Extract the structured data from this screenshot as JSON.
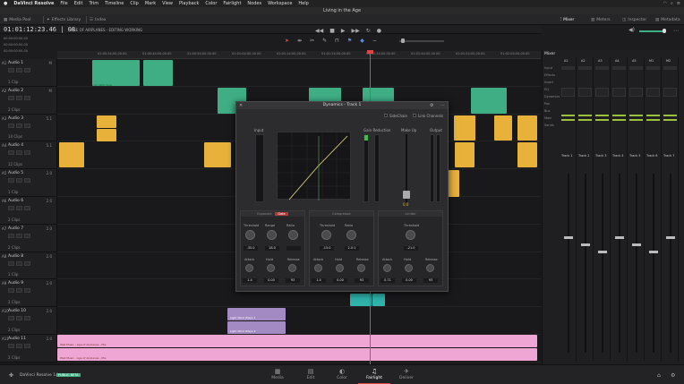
{
  "menubar": {
    "apple": "",
    "app": "DaVinci Resolve",
    "items": [
      "File",
      "Edit",
      "Trim",
      "Timeline",
      "Clip",
      "Mark",
      "View",
      "Playback",
      "Color",
      "Fairlight",
      "Nodes",
      "Workspace",
      "Help"
    ]
  },
  "window": {
    "title": "Living in the Age"
  },
  "toolbar": {
    "media_pool": "Media Pool",
    "effects_library": "Effects Library",
    "index": "Index",
    "mixer": "Mixer",
    "meters": "Meters",
    "inspector": "Inspector",
    "metadata": "Metadata"
  },
  "timeline": {
    "timecode": "01:01:12:23.46 | 08",
    "tc_sub": [
      "00:00:00:00.00",
      "00:00:00:00.00",
      "00:00:00:00.00"
    ],
    "name": "AGE OF AIRPLANES - EDITING WORKING",
    "ruler": [
      "01:00:34:00.00.00",
      "01:00:44:00.00.00",
      "01:00:54:00.00.00",
      "01:01:04:00.00.00",
      "01:01:14:00.00.00",
      "01:01:24:00.00.00",
      "01:01:34:00.00.00",
      "01:01:44:00.00.00",
      "01:01:54:00.00.00",
      "01:02:04:00.00.00"
    ]
  },
  "tracks": [
    {
      "id": "A1",
      "name": "Audio 1",
      "ch": "M",
      "clips": "1 Clip"
    },
    {
      "id": "A2",
      "name": "Audio 2",
      "ch": "M",
      "clips": "2 Clips"
    },
    {
      "id": "A3",
      "name": "Audio 3",
      "ch": "5.1",
      "clips": "14 Clips"
    },
    {
      "id": "A4",
      "name": "Audio 4",
      "ch": "5.1",
      "clips": "12 Clips"
    },
    {
      "id": "A5",
      "name": "Audio 5",
      "ch": "2.0",
      "clips": "1 Clip"
    },
    {
      "id": "A6",
      "name": "Audio 6",
      "ch": "2.0",
      "clips": "2 Clips"
    },
    {
      "id": "A7",
      "name": "Audio 7",
      "ch": "2.0",
      "clips": "2 Clips"
    },
    {
      "id": "A8",
      "name": "Audio 8",
      "ch": "2.0",
      "clips": "1 Clip"
    },
    {
      "id": "A9",
      "name": "Audio 9",
      "ch": "2.0",
      "clips": "2 Clips"
    },
    {
      "id": "A10",
      "name": "Audio 10",
      "ch": "2.0",
      "clips": "2 Clips"
    },
    {
      "id": "A11",
      "name": "Audio 11",
      "ch": "2.0",
      "clips": "2 Clips"
    }
  ],
  "clip_labels": {
    "light_wind_1": "Light Wind Wisps 1",
    "light_wind_2": "Light Wind Wisps 2",
    "wall": "Wall Music - Age of Airplanes - Mix",
    "a1": "A1_Wild_Amb"
  },
  "dynamics": {
    "title": "Dynamics - Track 1",
    "sidechain": "SideChain",
    "link_channels": "Link Channels",
    "input": "Input",
    "gain_reduction": "Gain Reduction",
    "make_up": "Make Up",
    "output": "Output",
    "makeup_value": "0.0",
    "sections": [
      {
        "name": "Expander",
        "mode": "Gate",
        "knobs": [
          {
            "label": "Threshold",
            "value": "-35.0"
          },
          {
            "label": "Range",
            "value": "18.0"
          },
          {
            "label": "Ratio",
            "value": ""
          }
        ],
        "knobs2": [
          {
            "label": "Attack",
            "value": "1.4"
          },
          {
            "label": "Hold",
            "value": "0.00"
          },
          {
            "label": "Release",
            "value": "93"
          }
        ]
      },
      {
        "name": "Compressor",
        "knobs": [
          {
            "label": "Threshold",
            "value": "-15.0"
          },
          {
            "label": "Ratio",
            "value": "2.0:1"
          }
        ],
        "knobs2": [
          {
            "label": "Attack",
            "value": "1.4"
          },
          {
            "label": "Hold",
            "value": "0.00"
          },
          {
            "label": "Release",
            "value": "93"
          }
        ]
      },
      {
        "name": "Limiter",
        "knobs": [
          {
            "label": "Threshold",
            "value": "-21.0"
          }
        ],
        "knobs2": [
          {
            "label": "Attack",
            "value": "0.71"
          },
          {
            "label": "Hold",
            "value": "0.00"
          },
          {
            "label": "Release",
            "value": "93"
          }
        ]
      }
    ]
  },
  "mixer": {
    "title": "Mixer",
    "channels": [
      "A1",
      "A2",
      "A3",
      "A4",
      "A5",
      "M1",
      "M2"
    ],
    "rows": [
      "Input",
      "Effects",
      "Insert",
      "EQ",
      "Dynamics",
      "Pan",
      "Bus",
      "Main",
      "Sends"
    ],
    "track_names": [
      "Track 1",
      "Track 2",
      "Track 3",
      "Track 4",
      "Track 5",
      "Track 6",
      "Track 7"
    ]
  },
  "pages": [
    {
      "label": "Media",
      "icon": "▦"
    },
    {
      "label": "Edit",
      "icon": "▤"
    },
    {
      "label": "Color",
      "icon": "◐"
    },
    {
      "label": "Fairlight",
      "icon": "♫"
    },
    {
      "label": "Deliver",
      "icon": "✈"
    }
  ],
  "status": {
    "app": "DaVinci Resolve 14",
    "badge": "PUBLIC BETA"
  }
}
